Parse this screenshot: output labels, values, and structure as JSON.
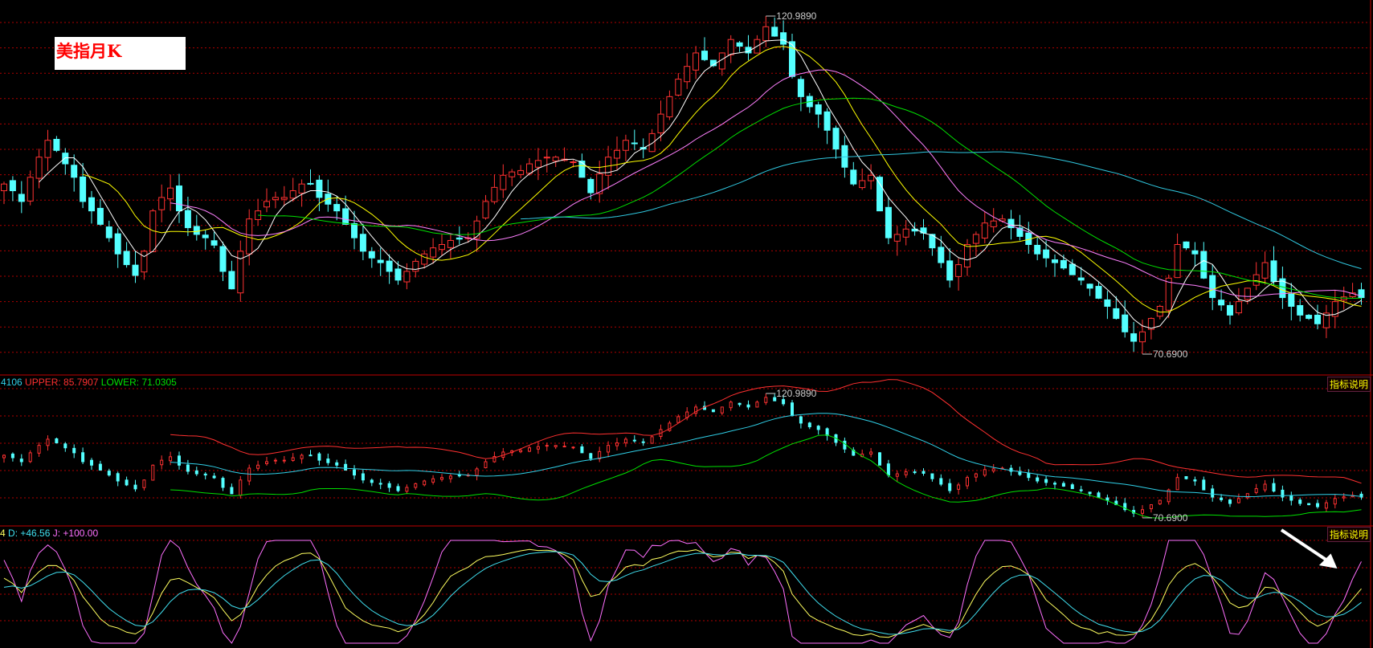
{
  "title": "美指月K",
  "panes": {
    "boll": {
      "mid_text": "4106",
      "upper_text": "UPPER: 85.7907",
      "lower_text": "LOWER: 71.0305",
      "explain": "指标说明"
    },
    "kdj": {
      "k_text": "4",
      "d_text": "D: +46.56",
      "j_text": "J: +100.00",
      "explain": "指标说明"
    }
  },
  "colors": {
    "up": "#ff3232",
    "down": "#54ffff",
    "grid": "#b00000",
    "ma5": "#ffffff",
    "ma10": "#ffff00",
    "ma20": "#ff80ff",
    "ma30": "#00e000",
    "ma60": "#30c8e0",
    "upper": "#ff3030",
    "lower": "#00e000",
    "mid": "#30d0e8",
    "k": "#ffff60",
    "d": "#40e0f0",
    "j": "#ff70ff"
  },
  "chart_data": {
    "type": "candlestick",
    "title": "美指月K",
    "max_label": "120.9890",
    "min_label": "70.6900",
    "max_value": 120.989,
    "min_value": 70.69,
    "close": [
      96,
      95,
      93.4,
      97,
      100,
      102.5,
      101,
      99,
      97,
      93.4,
      92,
      90,
      88,
      85.6,
      84,
      82.4,
      86,
      92,
      94,
      95.4,
      92,
      89.5,
      88.5,
      88,
      86.9,
      83,
      80.4,
      86,
      90.8,
      92,
      93.4,
      94,
      94,
      95,
      96,
      96,
      94,
      93,
      92,
      90,
      88,
      86,
      85,
      84.3,
      83,
      81.7,
      83,
      84.5,
      85.6,
      86.5,
      87,
      87.6,
      87.8,
      88,
      90.5,
      93.4,
      95.5,
      97.3,
      97.8,
      98,
      99,
      99.5,
      100,
      100,
      99.7,
      99.3,
      97,
      94.7,
      97.5,
      100,
      101,
      102.5,
      102,
      101.2,
      103.5,
      106.4,
      109,
      111.6,
      113.5,
      115.5,
      114.5,
      113.6,
      115.5,
      117.5,
      116.5,
      115.5,
      117.5,
      119.4,
      118,
      116.8,
      112,
      109,
      107.5,
      106.4,
      104,
      101.2,
      98.5,
      96,
      96.5,
      97.3,
      92,
      88,
      88.5,
      89.3,
      89,
      88.7,
      86.5,
      84.3,
      81.7,
      84,
      87,
      88.5,
      90.2,
      90.5,
      90.8,
      89.5,
      88.2,
      87,
      85.6,
      85,
      84.3,
      83.5,
      82.5,
      81.7,
      80.5,
      79,
      77.8,
      76,
      74,
      72.6,
      74,
      76,
      77.8,
      82,
      87,
      86.5,
      85.6,
      82,
      79.1,
      78,
      76.5,
      78.5,
      80.5,
      82.5,
      84.3,
      81.5,
      79.1,
      77.8,
      76.5,
      76,
      75.2,
      76.8,
      78.5,
      79.2,
      79.8,
      79.1
    ],
    "moving_averages": [
      5,
      10,
      20,
      30,
      60
    ],
    "indicators": [
      "BOLL(20,2)",
      "KDJ(9,3,3)"
    ],
    "grid": true
  }
}
